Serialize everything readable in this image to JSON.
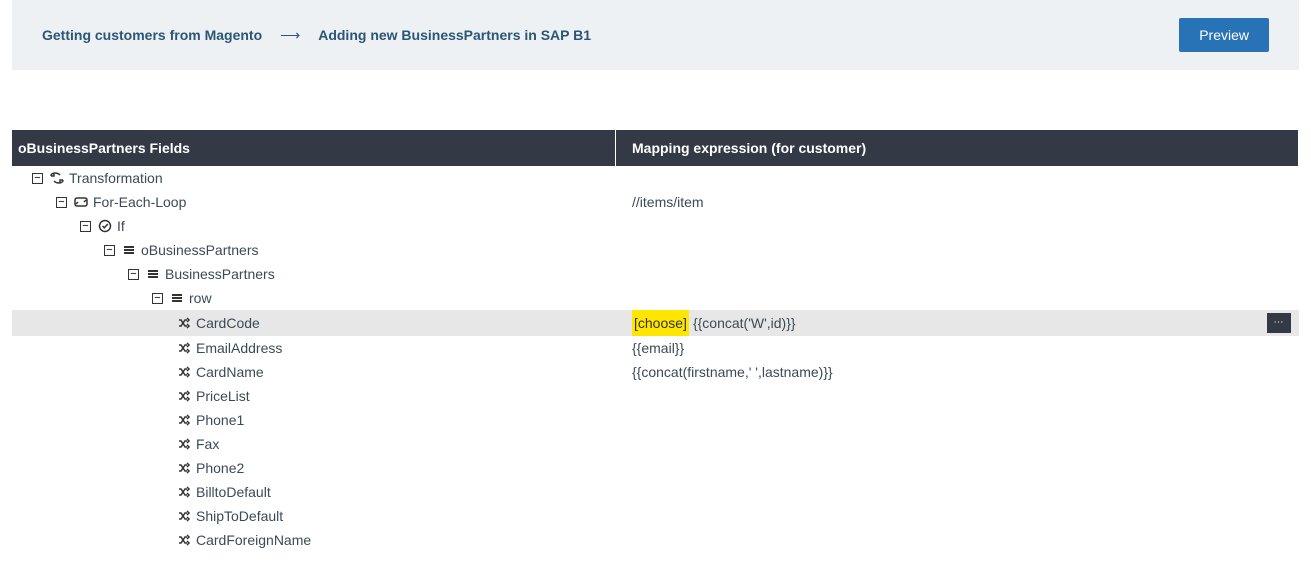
{
  "breadcrumb": {
    "source": "Getting customers from Magento",
    "target": "Adding new BusinessPartners in SAP B1"
  },
  "preview_label": "Preview",
  "table": {
    "header_left": "oBusinessPartners Fields",
    "header_right": "Mapping expression (for customer)"
  },
  "tree": [
    {
      "indent": 0,
      "collapse": true,
      "icon": "transform",
      "label": "Transformation",
      "mapping": "",
      "selected": false
    },
    {
      "indent": 1,
      "collapse": true,
      "icon": "loop",
      "label": "For-Each-Loop",
      "mapping": "//items/item",
      "selected": false
    },
    {
      "indent": 2,
      "collapse": true,
      "icon": "check",
      "label": "If",
      "mapping": "",
      "selected": false
    },
    {
      "indent": 3,
      "collapse": true,
      "icon": "bars",
      "label": "oBusinessPartners",
      "mapping": "",
      "selected": false
    },
    {
      "indent": 4,
      "collapse": true,
      "icon": "bars",
      "label": "BusinessPartners",
      "mapping": "",
      "selected": false
    },
    {
      "indent": 5,
      "collapse": true,
      "icon": "bars",
      "label": "row",
      "mapping": "",
      "selected": false
    },
    {
      "indent": 6,
      "collapse": false,
      "icon": "shuffle",
      "label": "CardCode",
      "mapping": "{{concat('W',id)}}",
      "choose": "[choose]",
      "selected": true
    },
    {
      "indent": 6,
      "collapse": false,
      "icon": "shuffle",
      "label": "EmailAddress",
      "mapping": "{{email}}",
      "selected": false
    },
    {
      "indent": 6,
      "collapse": false,
      "icon": "shuffle",
      "label": "CardName",
      "mapping": "{{concat(firstname,' ',lastname)}}",
      "selected": false
    },
    {
      "indent": 6,
      "collapse": false,
      "icon": "shuffle",
      "label": "PriceList",
      "mapping": "",
      "selected": false
    },
    {
      "indent": 6,
      "collapse": false,
      "icon": "shuffle",
      "label": "Phone1",
      "mapping": "",
      "selected": false
    },
    {
      "indent": 6,
      "collapse": false,
      "icon": "shuffle",
      "label": "Fax",
      "mapping": "",
      "selected": false
    },
    {
      "indent": 6,
      "collapse": false,
      "icon": "shuffle",
      "label": "Phone2",
      "mapping": "",
      "selected": false
    },
    {
      "indent": 6,
      "collapse": false,
      "icon": "shuffle",
      "label": "BilltoDefault",
      "mapping": "",
      "selected": false
    },
    {
      "indent": 6,
      "collapse": false,
      "icon": "shuffle",
      "label": "ShipToDefault",
      "mapping": "",
      "selected": false
    },
    {
      "indent": 6,
      "collapse": false,
      "icon": "shuffle",
      "label": "CardForeignName",
      "mapping": "",
      "selected": false
    }
  ],
  "row_action_label": "⋯"
}
